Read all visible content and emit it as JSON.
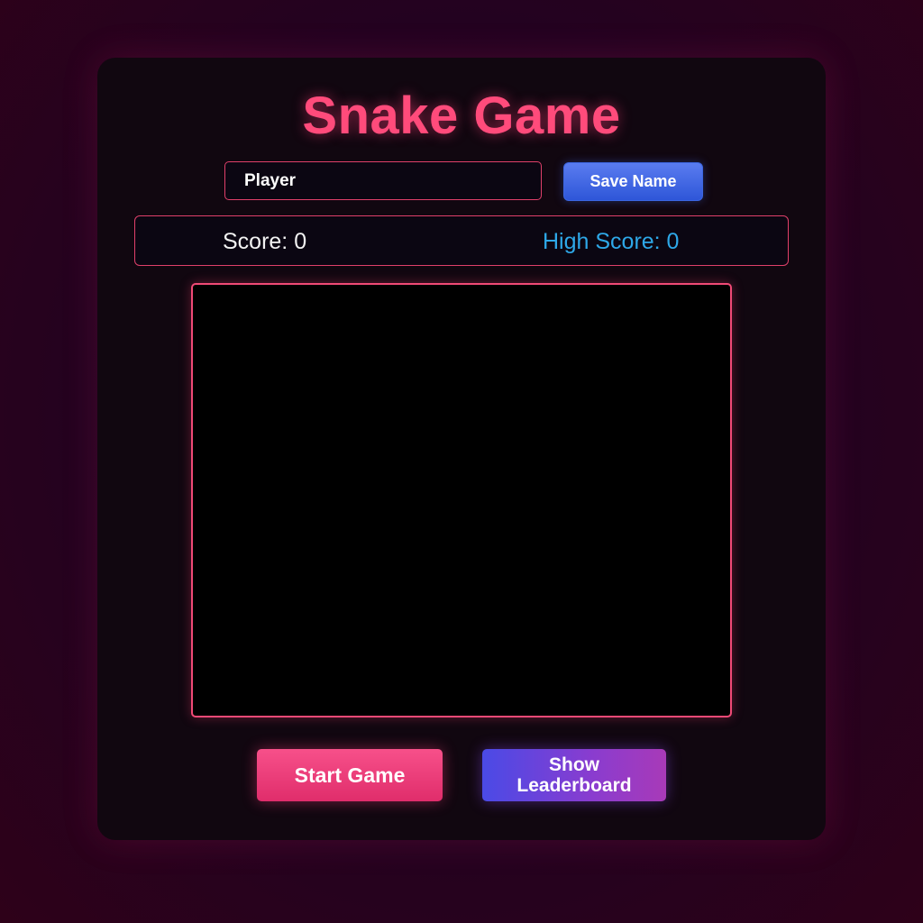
{
  "game": {
    "title": "Snake Game",
    "player_name": {
      "value": "Player",
      "placeholder": "Player"
    },
    "save_name_label": "Save Name",
    "score_label": "Score: 0",
    "high_score_label": "High Score: 0",
    "score": 0,
    "high_score": 0,
    "start_label": "Start Game",
    "leaderboard_label": "Show Leaderboard"
  },
  "colors": {
    "accent": "#ff4b7b",
    "high_score": "#2ea8e8",
    "save_button": "#2e56d8",
    "canvas_background": "#000000"
  }
}
